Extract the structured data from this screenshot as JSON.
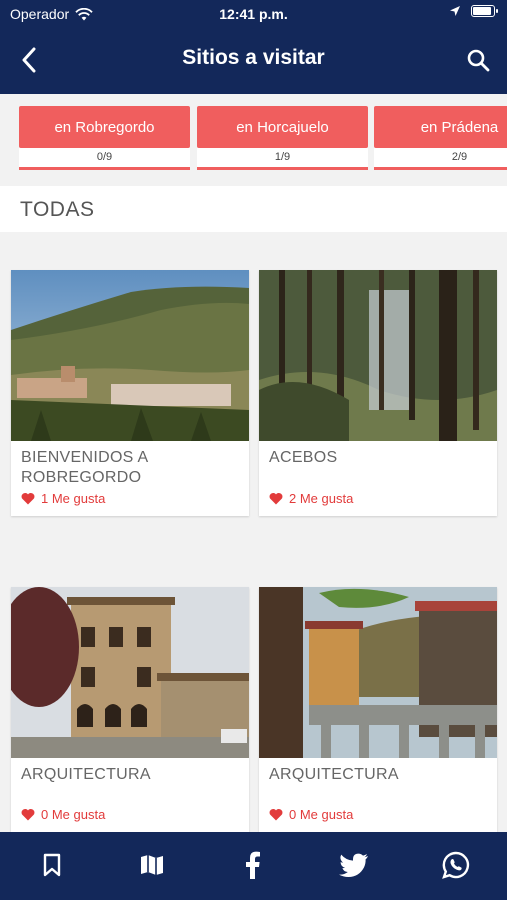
{
  "status": {
    "carrier": "Operador",
    "time": "12:41 p.m."
  },
  "nav": {
    "title": "Sitios a visitar"
  },
  "villages": [
    {
      "label": "en Robregordo",
      "count": "0/9"
    },
    {
      "label": "en Horcajuelo",
      "count": "1/9"
    },
    {
      "label": "en Prádena",
      "count": "2/9"
    }
  ],
  "section": {
    "title": "TODAS"
  },
  "sites": [
    {
      "name": "BIENVENIDOS A ROBREGORDO",
      "likes": "1 Me gusta"
    },
    {
      "name": "ACEBOS",
      "likes": "2 Me gusta"
    },
    {
      "name": "ARQUITECTURA",
      "likes": "0 Me gusta"
    },
    {
      "name": "ARQUITECTURA",
      "likes": "0 Me gusta"
    }
  ],
  "tabbar": [
    "bookmark-icon",
    "map-icon",
    "facebook-icon",
    "twitter-icon",
    "whatsapp-icon"
  ],
  "colors": {
    "navy": "#13285a",
    "accent": "#f05e5e",
    "like": "#e23b3b"
  }
}
